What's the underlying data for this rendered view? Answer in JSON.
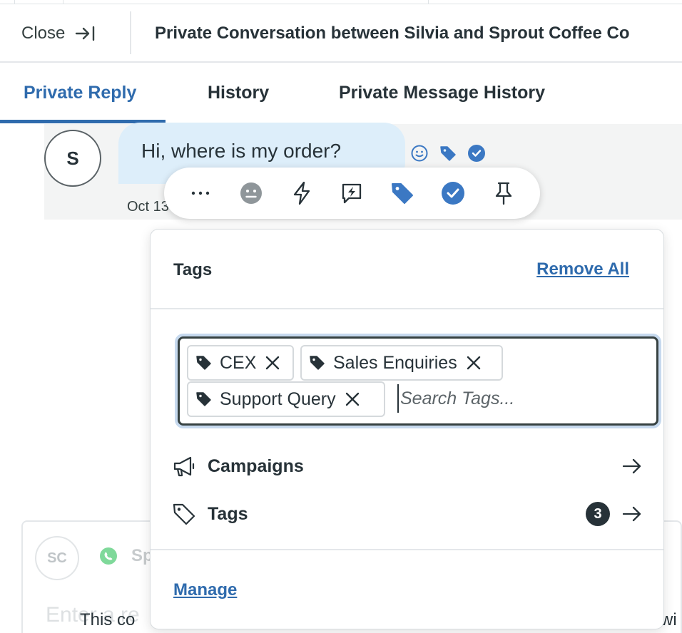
{
  "header": {
    "close_label": "Close",
    "title": "Private Conversation between Silvia and Sprout Coffee Co"
  },
  "tabs": [
    {
      "label": "Private Reply",
      "active": true
    },
    {
      "label": "History",
      "active": false
    },
    {
      "label": "Private Message History",
      "active": false
    }
  ],
  "message": {
    "avatar_initial": "S",
    "text": "Hi, where is my order?",
    "date": "Oct 13",
    "status_icons": [
      "smiley-icon",
      "tag-icon",
      "check-circle-icon"
    ]
  },
  "toolbar": {
    "icons": [
      "more-icon",
      "sentiment-icon",
      "lightning-icon",
      "reply-bolt-icon",
      "tag-icon",
      "complete-icon",
      "pin-icon"
    ]
  },
  "tags_popover": {
    "title": "Tags",
    "remove_all_label": "Remove All",
    "selected_tags": [
      "CEX",
      "Sales Enquiries",
      "Support Query"
    ],
    "search_placeholder": "Search Tags...",
    "menu": [
      {
        "label": "Campaigns",
        "icon": "megaphone-icon"
      },
      {
        "label": "Tags",
        "icon": "tag-outline-icon",
        "count": "3"
      }
    ],
    "manage_label": "Manage"
  },
  "compose": {
    "avatar_initials": "SC",
    "sender_name": "Sp",
    "placeholder": "Enter a re",
    "notice_start": "This co",
    "notice_end": "wi"
  },
  "colors": {
    "accent": "#2f6bad",
    "tag_blue": "#3b78c3",
    "bubble": "#ddeefa",
    "text": "#273238",
    "whatsapp": "#25d366"
  }
}
